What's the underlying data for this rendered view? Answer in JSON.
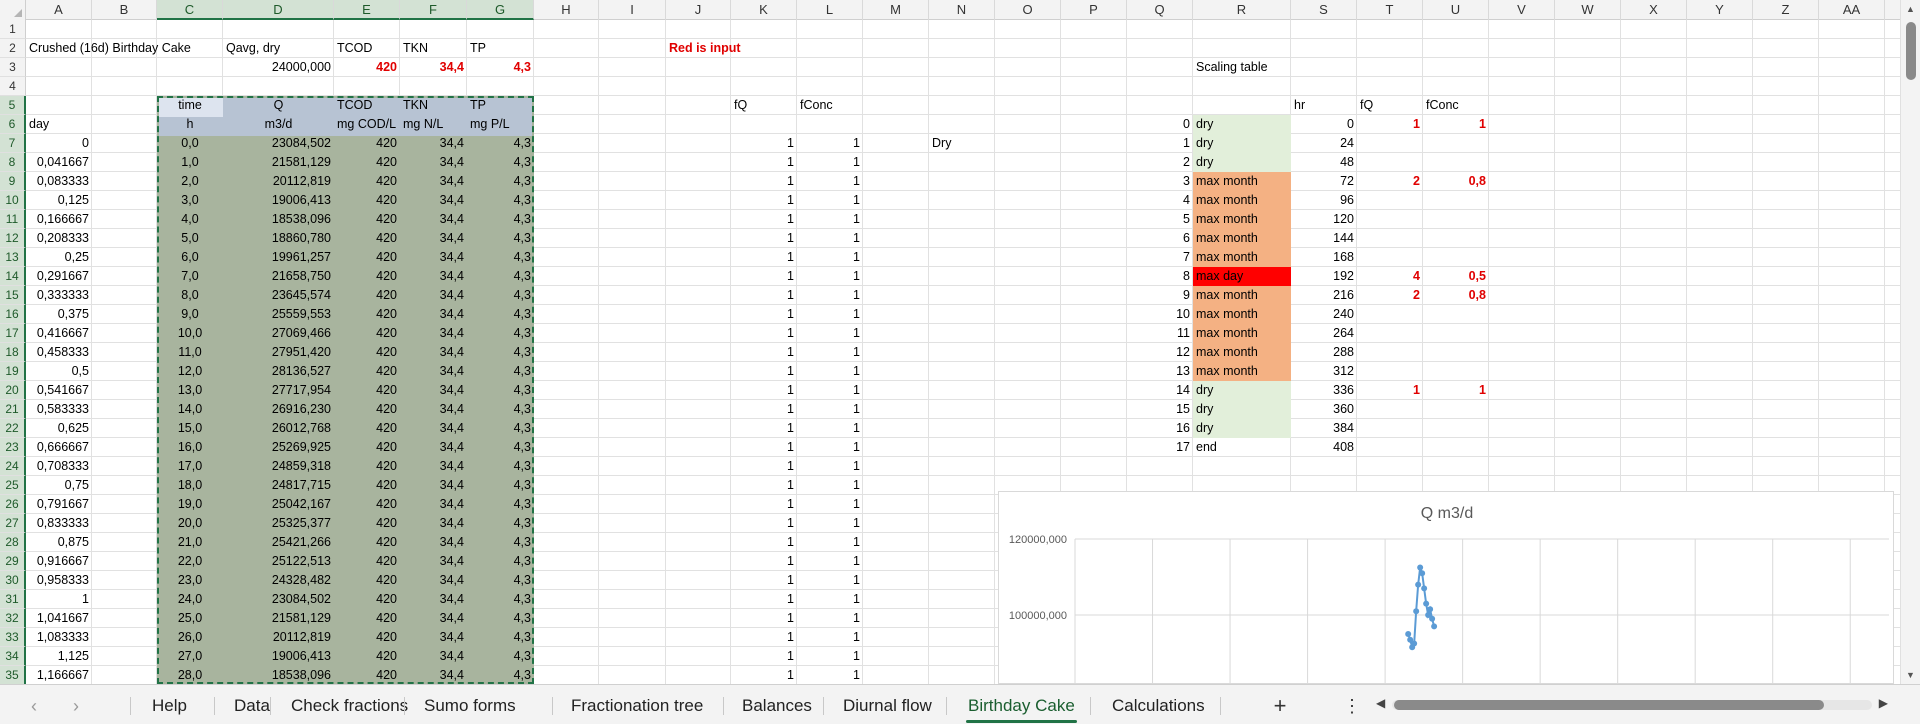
{
  "columns": [
    "A",
    "B",
    "C",
    "D",
    "E",
    "F",
    "G",
    "H",
    "I",
    "J",
    "K",
    "L",
    "M",
    "N",
    "O",
    "P",
    "Q",
    "R",
    "S",
    "T",
    "U",
    "V",
    "W",
    "X",
    "Y",
    "Z",
    "AA"
  ],
  "rows": [
    "1",
    "2",
    "3",
    "4",
    "5",
    "6",
    "7",
    "8",
    "9",
    "10",
    "11",
    "12",
    "13",
    "14",
    "15",
    "16",
    "17",
    "18",
    "19",
    "20",
    "21",
    "22",
    "23",
    "24",
    "25",
    "26",
    "27",
    "28",
    "29",
    "30",
    "31",
    "32",
    "33",
    "34",
    "35"
  ],
  "header": {
    "title": "Crushed (16d) Birthday Cake",
    "qavg_label": "Qavg, dry",
    "tcod_label": "TCOD",
    "tkn_label": "TKN",
    "tp_label": "TP",
    "red_note": "Red is input",
    "qavg_value": "24000,000",
    "tcod_value": "420",
    "tkn_value": "34,4",
    "tp_value": "4,3",
    "scaling_title": "Scaling table"
  },
  "table": {
    "day_label": "day",
    "head1": [
      "time",
      "Q",
      "TCOD",
      "TKN",
      "TP"
    ],
    "head2": [
      "h",
      "m3/d",
      "mg COD/L",
      "mg N/L",
      "mg P/L"
    ],
    "fq_label": "fQ",
    "fconc_label": "fConc",
    "dry_label": "Dry",
    "day": [
      "0",
      "0,041667",
      "0,083333",
      "0,125",
      "0,166667",
      "0,208333",
      "0,25",
      "0,291667",
      "0,333333",
      "0,375",
      "0,416667",
      "0,458333",
      "0,5",
      "0,541667",
      "0,583333",
      "0,625",
      "0,666667",
      "0,708333",
      "0,75",
      "0,791667",
      "0,833333",
      "0,875",
      "0,916667",
      "0,958333",
      "1",
      "1,041667",
      "1,083333",
      "1,125",
      "1,166667"
    ],
    "time": [
      "0,0",
      "1,0",
      "2,0",
      "3,0",
      "4,0",
      "5,0",
      "6,0",
      "7,0",
      "8,0",
      "9,0",
      "10,0",
      "11,0",
      "12,0",
      "13,0",
      "14,0",
      "15,0",
      "16,0",
      "17,0",
      "18,0",
      "19,0",
      "20,0",
      "21,0",
      "22,0",
      "23,0",
      "24,0",
      "25,0",
      "26,0",
      "27,0",
      "28,0"
    ],
    "q": [
      "23084,502",
      "21581,129",
      "20112,819",
      "19006,413",
      "18538,096",
      "18860,780",
      "19961,257",
      "21658,750",
      "23645,574",
      "25559,553",
      "27069,466",
      "27951,420",
      "28136,527",
      "27717,954",
      "26916,230",
      "26012,768",
      "25269,925",
      "24859,318",
      "24817,715",
      "25042,167",
      "25325,377",
      "25421,266",
      "25122,513",
      "24328,482",
      "23084,502",
      "21581,129",
      "20112,819",
      "19006,413",
      "18538,096"
    ],
    "tcod": "420",
    "tkn": "34,4",
    "tp": "4,3",
    "one": "1"
  },
  "scaling": {
    "hr_label": "hr",
    "fq_label": "fQ",
    "fconc_label": "fConc",
    "rows": [
      {
        "idx": "0",
        "period": "dry",
        "hr": "0",
        "fq": "1",
        "fconc": "1",
        "kind": "dry"
      },
      {
        "idx": "1",
        "period": "dry",
        "hr": "24",
        "fq": "",
        "fconc": "",
        "kind": "dry"
      },
      {
        "idx": "2",
        "period": "dry",
        "hr": "48",
        "fq": "",
        "fconc": "",
        "kind": "dry"
      },
      {
        "idx": "3",
        "period": "max month",
        "hr": "72",
        "fq": "2",
        "fconc": "0,8",
        "kind": "month"
      },
      {
        "idx": "4",
        "period": "max month",
        "hr": "96",
        "fq": "",
        "fconc": "",
        "kind": "month"
      },
      {
        "idx": "5",
        "period": "max month",
        "hr": "120",
        "fq": "",
        "fconc": "",
        "kind": "month"
      },
      {
        "idx": "6",
        "period": "max month",
        "hr": "144",
        "fq": "",
        "fconc": "",
        "kind": "month"
      },
      {
        "idx": "7",
        "period": "max month",
        "hr": "168",
        "fq": "",
        "fconc": "",
        "kind": "month"
      },
      {
        "idx": "8",
        "period": "max day",
        "hr": "192",
        "fq": "4",
        "fconc": "0,5",
        "kind": "day"
      },
      {
        "idx": "9",
        "period": "max month",
        "hr": "216",
        "fq": "2",
        "fconc": "0,8",
        "kind": "month"
      },
      {
        "idx": "10",
        "period": "max month",
        "hr": "240",
        "fq": "",
        "fconc": "",
        "kind": "month"
      },
      {
        "idx": "11",
        "period": "max month",
        "hr": "264",
        "fq": "",
        "fconc": "",
        "kind": "month"
      },
      {
        "idx": "12",
        "period": "max month",
        "hr": "288",
        "fq": "",
        "fconc": "",
        "kind": "month"
      },
      {
        "idx": "13",
        "period": "max month",
        "hr": "312",
        "fq": "",
        "fconc": "",
        "kind": "month"
      },
      {
        "idx": "14",
        "period": "dry",
        "hr": "336",
        "fq": "1",
        "fconc": "1",
        "kind": "dry"
      },
      {
        "idx": "15",
        "period": "dry",
        "hr": "360",
        "fq": "",
        "fconc": "",
        "kind": "dry"
      },
      {
        "idx": "16",
        "period": "dry",
        "hr": "384",
        "fq": "",
        "fconc": "",
        "kind": "dry"
      },
      {
        "idx": "17",
        "period": "end",
        "hr": "408",
        "fq": "",
        "fconc": "",
        "kind": "none"
      }
    ]
  },
  "chart_data": {
    "type": "line",
    "title": "Q m3/d",
    "ytick_labels": [
      "120000,000",
      "100000,000"
    ],
    "y_visible_range": [
      92000,
      120000
    ],
    "x_visible_range": [
      0,
      408
    ],
    "series": [
      {
        "x": [
          167,
          168,
          169,
          170,
          171,
          172,
          173,
          174,
          175,
          176,
          177,
          178,
          179,
          180
        ],
        "y": [
          95000,
          93500,
          91500,
          92500,
          101000,
          108000,
          112500,
          111000,
          107000,
          103000,
          100000,
          101500,
          99000,
          97000
        ]
      }
    ],
    "colors": {
      "line": "#5b9bd5"
    }
  },
  "tabs": [
    "Help",
    "Data",
    "Check fractions",
    "Sumo forms",
    "Fractionation tree",
    "Balances",
    "Diurnal flow",
    "Birthday Cake",
    "Calculations"
  ],
  "active_tab": "Birthday Cake",
  "add_sheet_label": "+",
  "more_label": "⋮"
}
